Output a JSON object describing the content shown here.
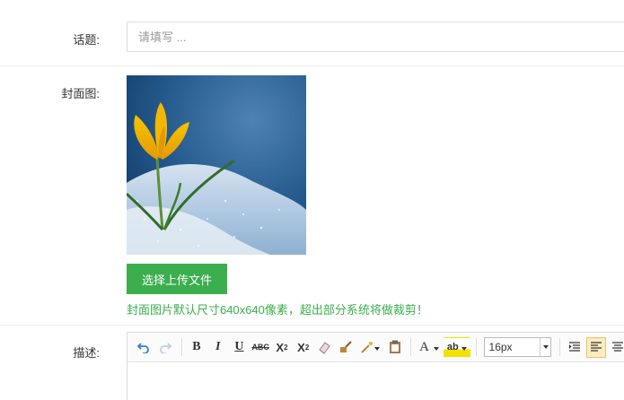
{
  "topic": {
    "label": "话题:",
    "placeholder": "请填写 ...",
    "value": ""
  },
  "cover": {
    "label": "封面图:",
    "image": "crocus-flower-in-snow",
    "upload_label": "选择上传文件",
    "hint": "封面图片默认尺寸640x640像素，超出部分系统将做裁剪！"
  },
  "description": {
    "label": "描述:",
    "font_size": "16px",
    "toolbar": [
      "undo-icon",
      "redo-icon",
      "bold-icon",
      "italic-icon",
      "underline-icon",
      "strikethrough-icon",
      "superscript-icon",
      "subscript-icon",
      "eraser-icon",
      "format-brush-icon",
      "magic-wand-icon",
      "paste-plain-icon",
      "font-color-icon",
      "highlight-color-icon",
      "font-size-select",
      "indent-icon",
      "align-left-icon",
      "align-center-icon"
    ]
  },
  "colors": {
    "accent": "#3bae4e",
    "border": "#dcdcdc"
  }
}
